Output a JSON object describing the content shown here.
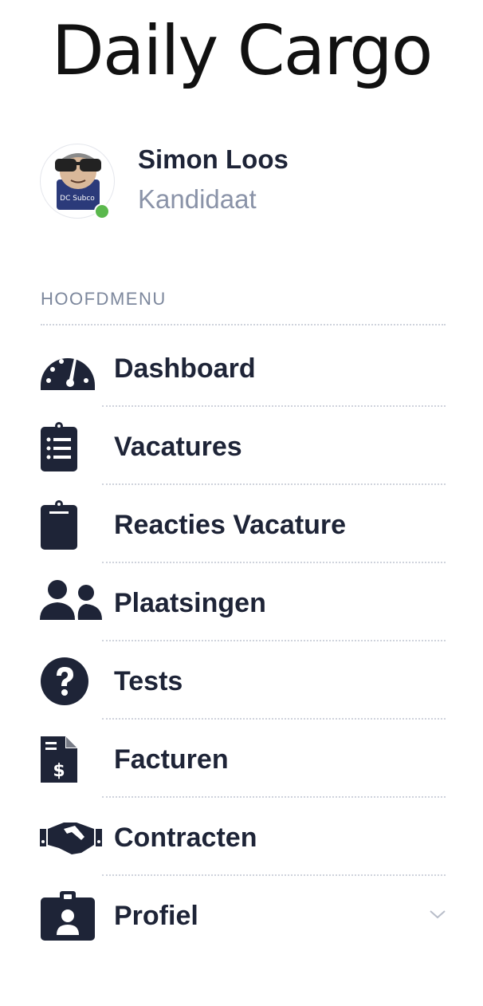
{
  "brand": {
    "logo_text": "Daily Cargo"
  },
  "user": {
    "name": "Simon Loos",
    "role": "Kandidaat",
    "avatar_text": "DC Subco",
    "status_color": "#5bb84d"
  },
  "menu": {
    "heading": "HOOFDMENU",
    "items": [
      {
        "label": "Dashboard",
        "icon": "tachometer-icon"
      },
      {
        "label": "Vacatures",
        "icon": "clipboard-list-icon"
      },
      {
        "label": "Reacties Vacature",
        "icon": "clipboard-icon"
      },
      {
        "label": "Plaatsingen",
        "icon": "users-icon"
      },
      {
        "label": "Tests",
        "icon": "question-circle-icon"
      },
      {
        "label": "Facturen",
        "icon": "file-invoice-dollar-icon"
      },
      {
        "label": "Contracten",
        "icon": "handshake-icon"
      },
      {
        "label": "Profiel",
        "icon": "id-badge-icon",
        "has_submenu": true
      }
    ]
  },
  "colors": {
    "text_primary": "#1e2437",
    "text_muted": "#8a93a8",
    "icon": "#1e2437",
    "divider": "#cfd3dc"
  }
}
